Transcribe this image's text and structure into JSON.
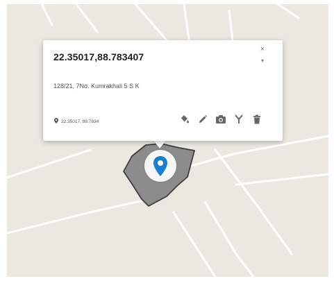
{
  "popup": {
    "title": "22.35017,88.783407",
    "address": "128/21, 7No. Kumrakhali 5 S K",
    "coords": "22.35017, 88.7834",
    "close_glyph": "×",
    "expand_glyph": "▾"
  },
  "icons": {
    "coords": "location-pin-icon",
    "marker": "map-marker-icon",
    "actions": [
      "paint-bucket-icon",
      "pencil-icon",
      "camera-icon",
      "fork-icon",
      "trash-icon"
    ],
    "close": "close-icon",
    "expand": "chevron-down-icon"
  },
  "colors": {
    "map_background": "#ebe8e1",
    "road": "#ffffff",
    "parcel_fill": "#8c8c8a",
    "marker": "#1a7fd1"
  }
}
